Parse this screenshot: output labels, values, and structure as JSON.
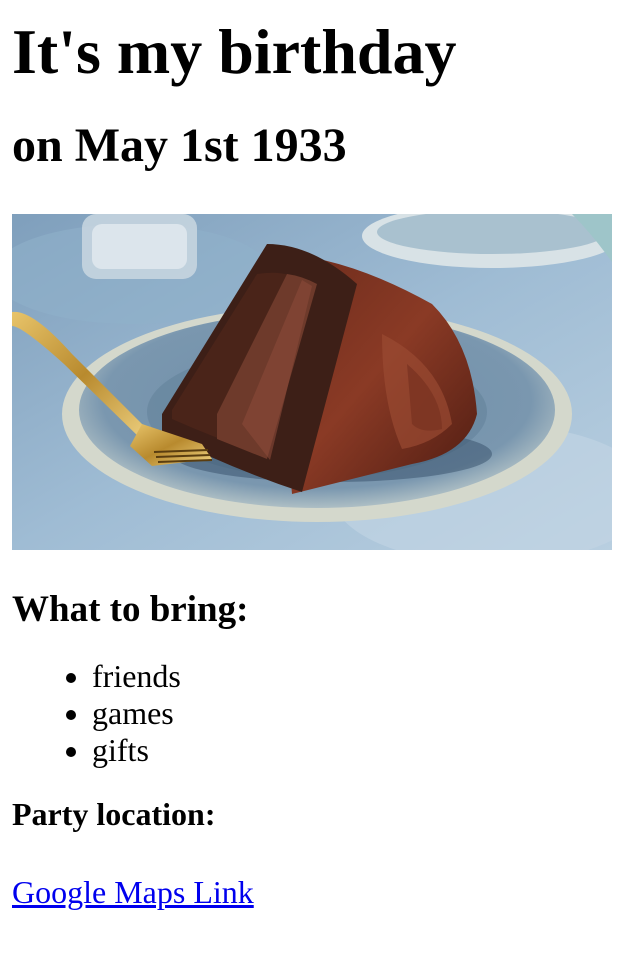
{
  "heading": "It's my birthday",
  "subheading": "on May 1st 1933",
  "image": {
    "subject": "slice of chocolate layer cake with a gold fork on a blue plate"
  },
  "bring_section": {
    "title": "What to bring:",
    "items": [
      "friends",
      "games",
      "gifts"
    ]
  },
  "location_section": {
    "title": "Party location:",
    "link_text": "Google Maps Link"
  },
  "colors": {
    "link": "#0000ee",
    "text": "#000000",
    "background": "#ffffff"
  }
}
